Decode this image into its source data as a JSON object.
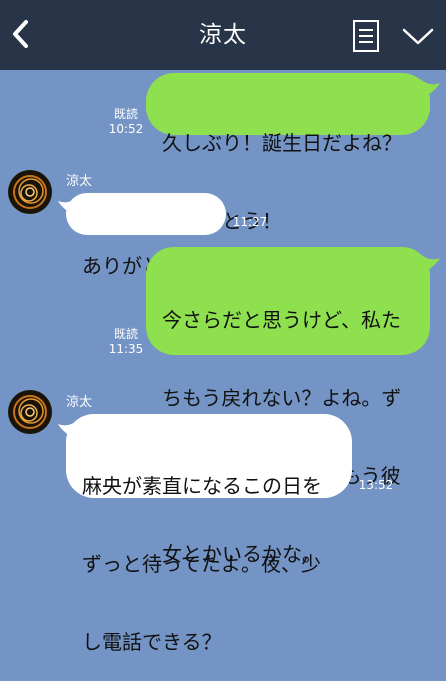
{
  "header": {
    "title": "涼太",
    "back_icon": "chevron-left-icon",
    "menu_icon": "notes-list-icon",
    "expand_icon": "chevron-down-icon"
  },
  "messages": [
    {
      "direction": "sent",
      "lines": [
        "久しぶり！誕生日だよね？",
        "おめでとう！"
      ],
      "read_label": "既読",
      "time": "10:52"
    },
    {
      "direction": "received",
      "sender": "涼太",
      "lines": [
        "ありがとう！"
      ],
      "time": "11:27"
    },
    {
      "direction": "sent",
      "lines": [
        "今さらだと思うけど、私た",
        "ちもう戻れない？よね。ず",
        "っと後悔してたの…もう彼",
        "女とかいるかな。"
      ],
      "read_label": "既読",
      "time": "11:35"
    },
    {
      "direction": "received",
      "sender": "涼太",
      "lines": [
        "麻央が素直になるこの日を",
        "ずっと待ってたよ。夜、少",
        "し電話できる？"
      ],
      "time": "13:52"
    }
  ],
  "colors": {
    "header_bg": "#283447",
    "chat_bg": "#7394c4",
    "sent_bubble": "#8ee04f",
    "received_bubble": "#ffffff"
  }
}
